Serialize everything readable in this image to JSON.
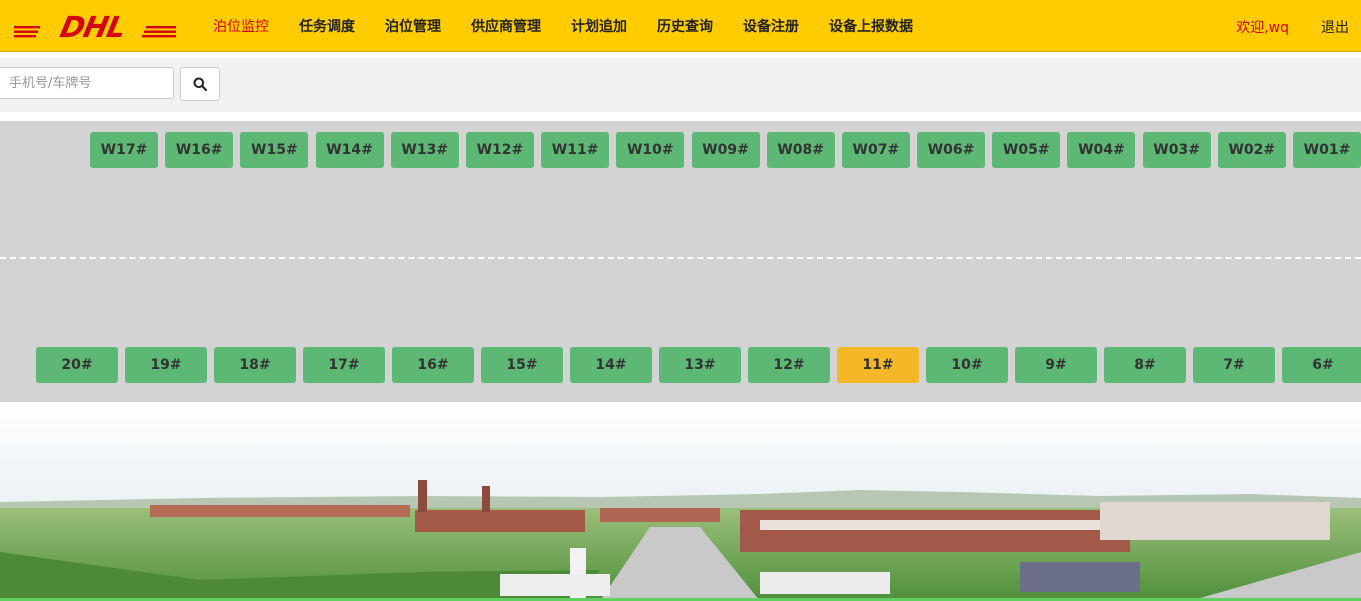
{
  "brand": {
    "name": "DHL",
    "colors": {
      "yellow": "#ffcc00",
      "red": "#d40511"
    }
  },
  "nav": [
    {
      "label": "泊位监控",
      "active": true
    },
    {
      "label": "任务调度"
    },
    {
      "label": "泊位管理"
    },
    {
      "label": "供应商管理"
    },
    {
      "label": "计划追加"
    },
    {
      "label": "历史查询"
    },
    {
      "label": "设备注册"
    },
    {
      "label": "设备上报数据"
    }
  ],
  "user": {
    "welcome": "欢迎,wq",
    "logout": "退出"
  },
  "search": {
    "placeholder": "手机号/车牌号",
    "value": "",
    "icon": "search-icon"
  },
  "docks_top": [
    "W17#",
    "W16#",
    "W15#",
    "W14#",
    "W13#",
    "W12#",
    "W11#",
    "W10#",
    "W09#",
    "W08#",
    "W07#",
    "W06#",
    "W05#",
    "W04#",
    "W03#",
    "W02#",
    "W01#"
  ],
  "docks_bottom": [
    {
      "label": "20#",
      "status": "free"
    },
    {
      "label": "19#",
      "status": "free"
    },
    {
      "label": "18#",
      "status": "free"
    },
    {
      "label": "17#",
      "status": "free"
    },
    {
      "label": "16#",
      "status": "free"
    },
    {
      "label": "15#",
      "status": "free"
    },
    {
      "label": "14#",
      "status": "free"
    },
    {
      "label": "13#",
      "status": "free"
    },
    {
      "label": "12#",
      "status": "free"
    },
    {
      "label": "11#",
      "status": "busy"
    },
    {
      "label": "10#",
      "status": "free"
    },
    {
      "label": "9#",
      "status": "free"
    },
    {
      "label": "8#",
      "status": "free"
    },
    {
      "label": "7#",
      "status": "free"
    },
    {
      "label": "6#",
      "status": "free"
    }
  ],
  "status_colors": {
    "free": "#5cb874",
    "busy": "#f5b727"
  }
}
